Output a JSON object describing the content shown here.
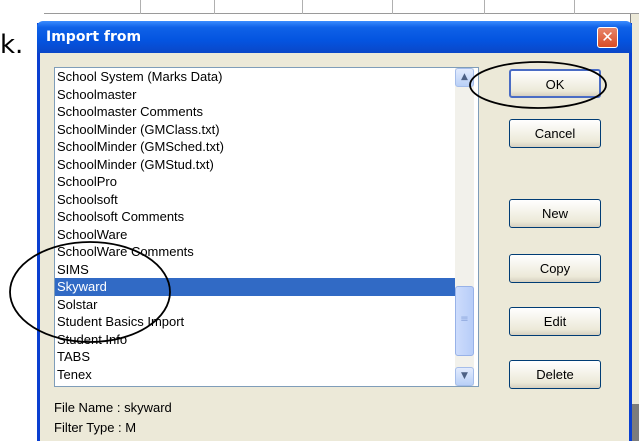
{
  "slide": {
    "bullet": "k."
  },
  "dialog": {
    "title": "Import from",
    "close_glyph": "✕",
    "items": [
      {
        "label": "School System (Marks Data)",
        "selected": false
      },
      {
        "label": "Schoolmaster",
        "selected": false
      },
      {
        "label": "Schoolmaster Comments",
        "selected": false
      },
      {
        "label": "SchoolMinder (GMClass.txt)",
        "selected": false
      },
      {
        "label": "SchoolMinder (GMSched.txt)",
        "selected": false
      },
      {
        "label": "SchoolMinder (GMStud.txt)",
        "selected": false
      },
      {
        "label": "SchoolPro",
        "selected": false
      },
      {
        "label": "Schoolsoft",
        "selected": false
      },
      {
        "label": "Schoolsoft Comments",
        "selected": false
      },
      {
        "label": "SchoolWare",
        "selected": false
      },
      {
        "label": "SchoolWare Comments",
        "selected": false
      },
      {
        "label": "SIMS",
        "selected": false
      },
      {
        "label": "Skyward",
        "selected": true
      },
      {
        "label": "Solstar",
        "selected": false
      },
      {
        "label": "Student Basics Import",
        "selected": false
      },
      {
        "label": "Student Info",
        "selected": false
      },
      {
        "label": "TABS",
        "selected": false
      },
      {
        "label": "Tenex",
        "selected": false
      }
    ],
    "buttons": {
      "ok": "OK",
      "cancel": "Cancel",
      "new": "New",
      "copy": "Copy",
      "edit": "Edit",
      "delete": "Delete"
    },
    "file_name": "File Name  :  skyward",
    "filter_type": "Filter Type :  M"
  },
  "colors": {
    "titlebar": "#0454e0",
    "selection": "#316ac5",
    "dialog_bg": "#ece9d8"
  }
}
